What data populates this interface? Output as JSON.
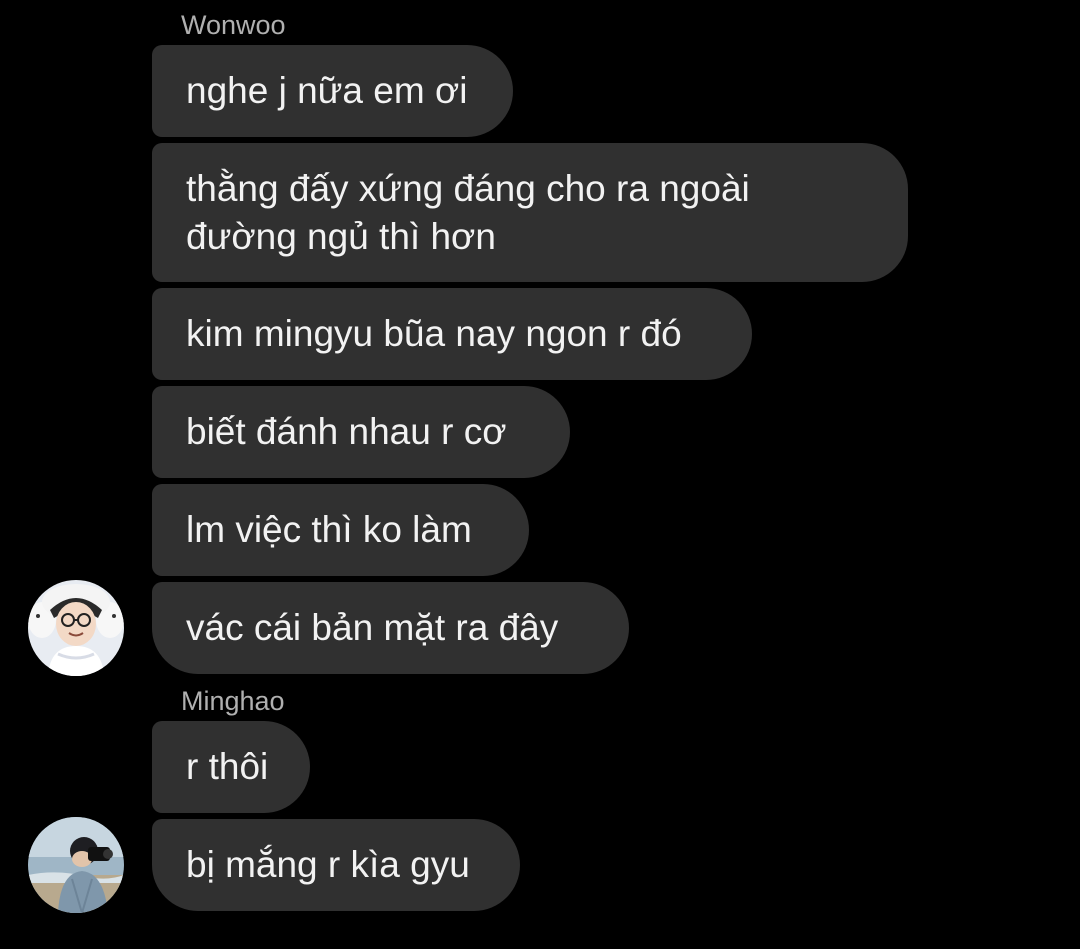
{
  "conversation": {
    "groups": [
      {
        "sender": "Wonwoo",
        "avatar_icon": "avatar-wonwoo",
        "messages": [
          "nghe j nữa em ơi",
          "thằng đấy xứng đáng cho ra ngoài đường ngủ thì hơn",
          "kim mingyu bũa nay ngon r đó",
          "biết đánh nhau r cơ",
          "lm việc thì ko làm",
          "vác cái bản mặt ra đây"
        ]
      },
      {
        "sender": "Minghao",
        "avatar_icon": "avatar-minghao",
        "messages": [
          "r thôi",
          "bị mắng r kìa gyu"
        ]
      }
    ]
  },
  "colors": {
    "background": "#000000",
    "bubble": "#303030",
    "text": "#f2f2f2",
    "sender_name": "#b0b0b0"
  }
}
